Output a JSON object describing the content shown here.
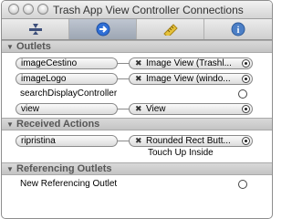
{
  "window": {
    "title": "Trash App View Controller Connections"
  },
  "toolbar": {
    "tabs": [
      {
        "icon": "attributes-icon",
        "selected": false
      },
      {
        "icon": "connections-icon",
        "selected": true
      },
      {
        "icon": "size-ruler-icon",
        "selected": false
      },
      {
        "icon": "identity-info-icon",
        "selected": false
      }
    ],
    "info_glyph": "i"
  },
  "outlets": {
    "header": "Outlets",
    "items": [
      {
        "name": "imageCestino",
        "target": "Image View (Trashl...",
        "connected": true
      },
      {
        "name": "imageLogo",
        "target": "Image View (windo...",
        "connected": true
      },
      {
        "name": "searchDisplayController",
        "target": "",
        "connected": false
      },
      {
        "name": "view",
        "target": "View",
        "connected": true
      }
    ]
  },
  "received_actions": {
    "header": "Received Actions",
    "items": [
      {
        "name": "ripristina",
        "target": "Rounded Rect Butt...",
        "event": "Touch Up Inside",
        "connected": true
      }
    ]
  },
  "referencing_outlets": {
    "header": "Referencing Outlets",
    "items": [
      {
        "name": "New Referencing Outlet",
        "connected": false
      }
    ]
  },
  "colors": {
    "selected_tab": "#a9b1bd",
    "connections_icon": "#2f6fd6"
  }
}
